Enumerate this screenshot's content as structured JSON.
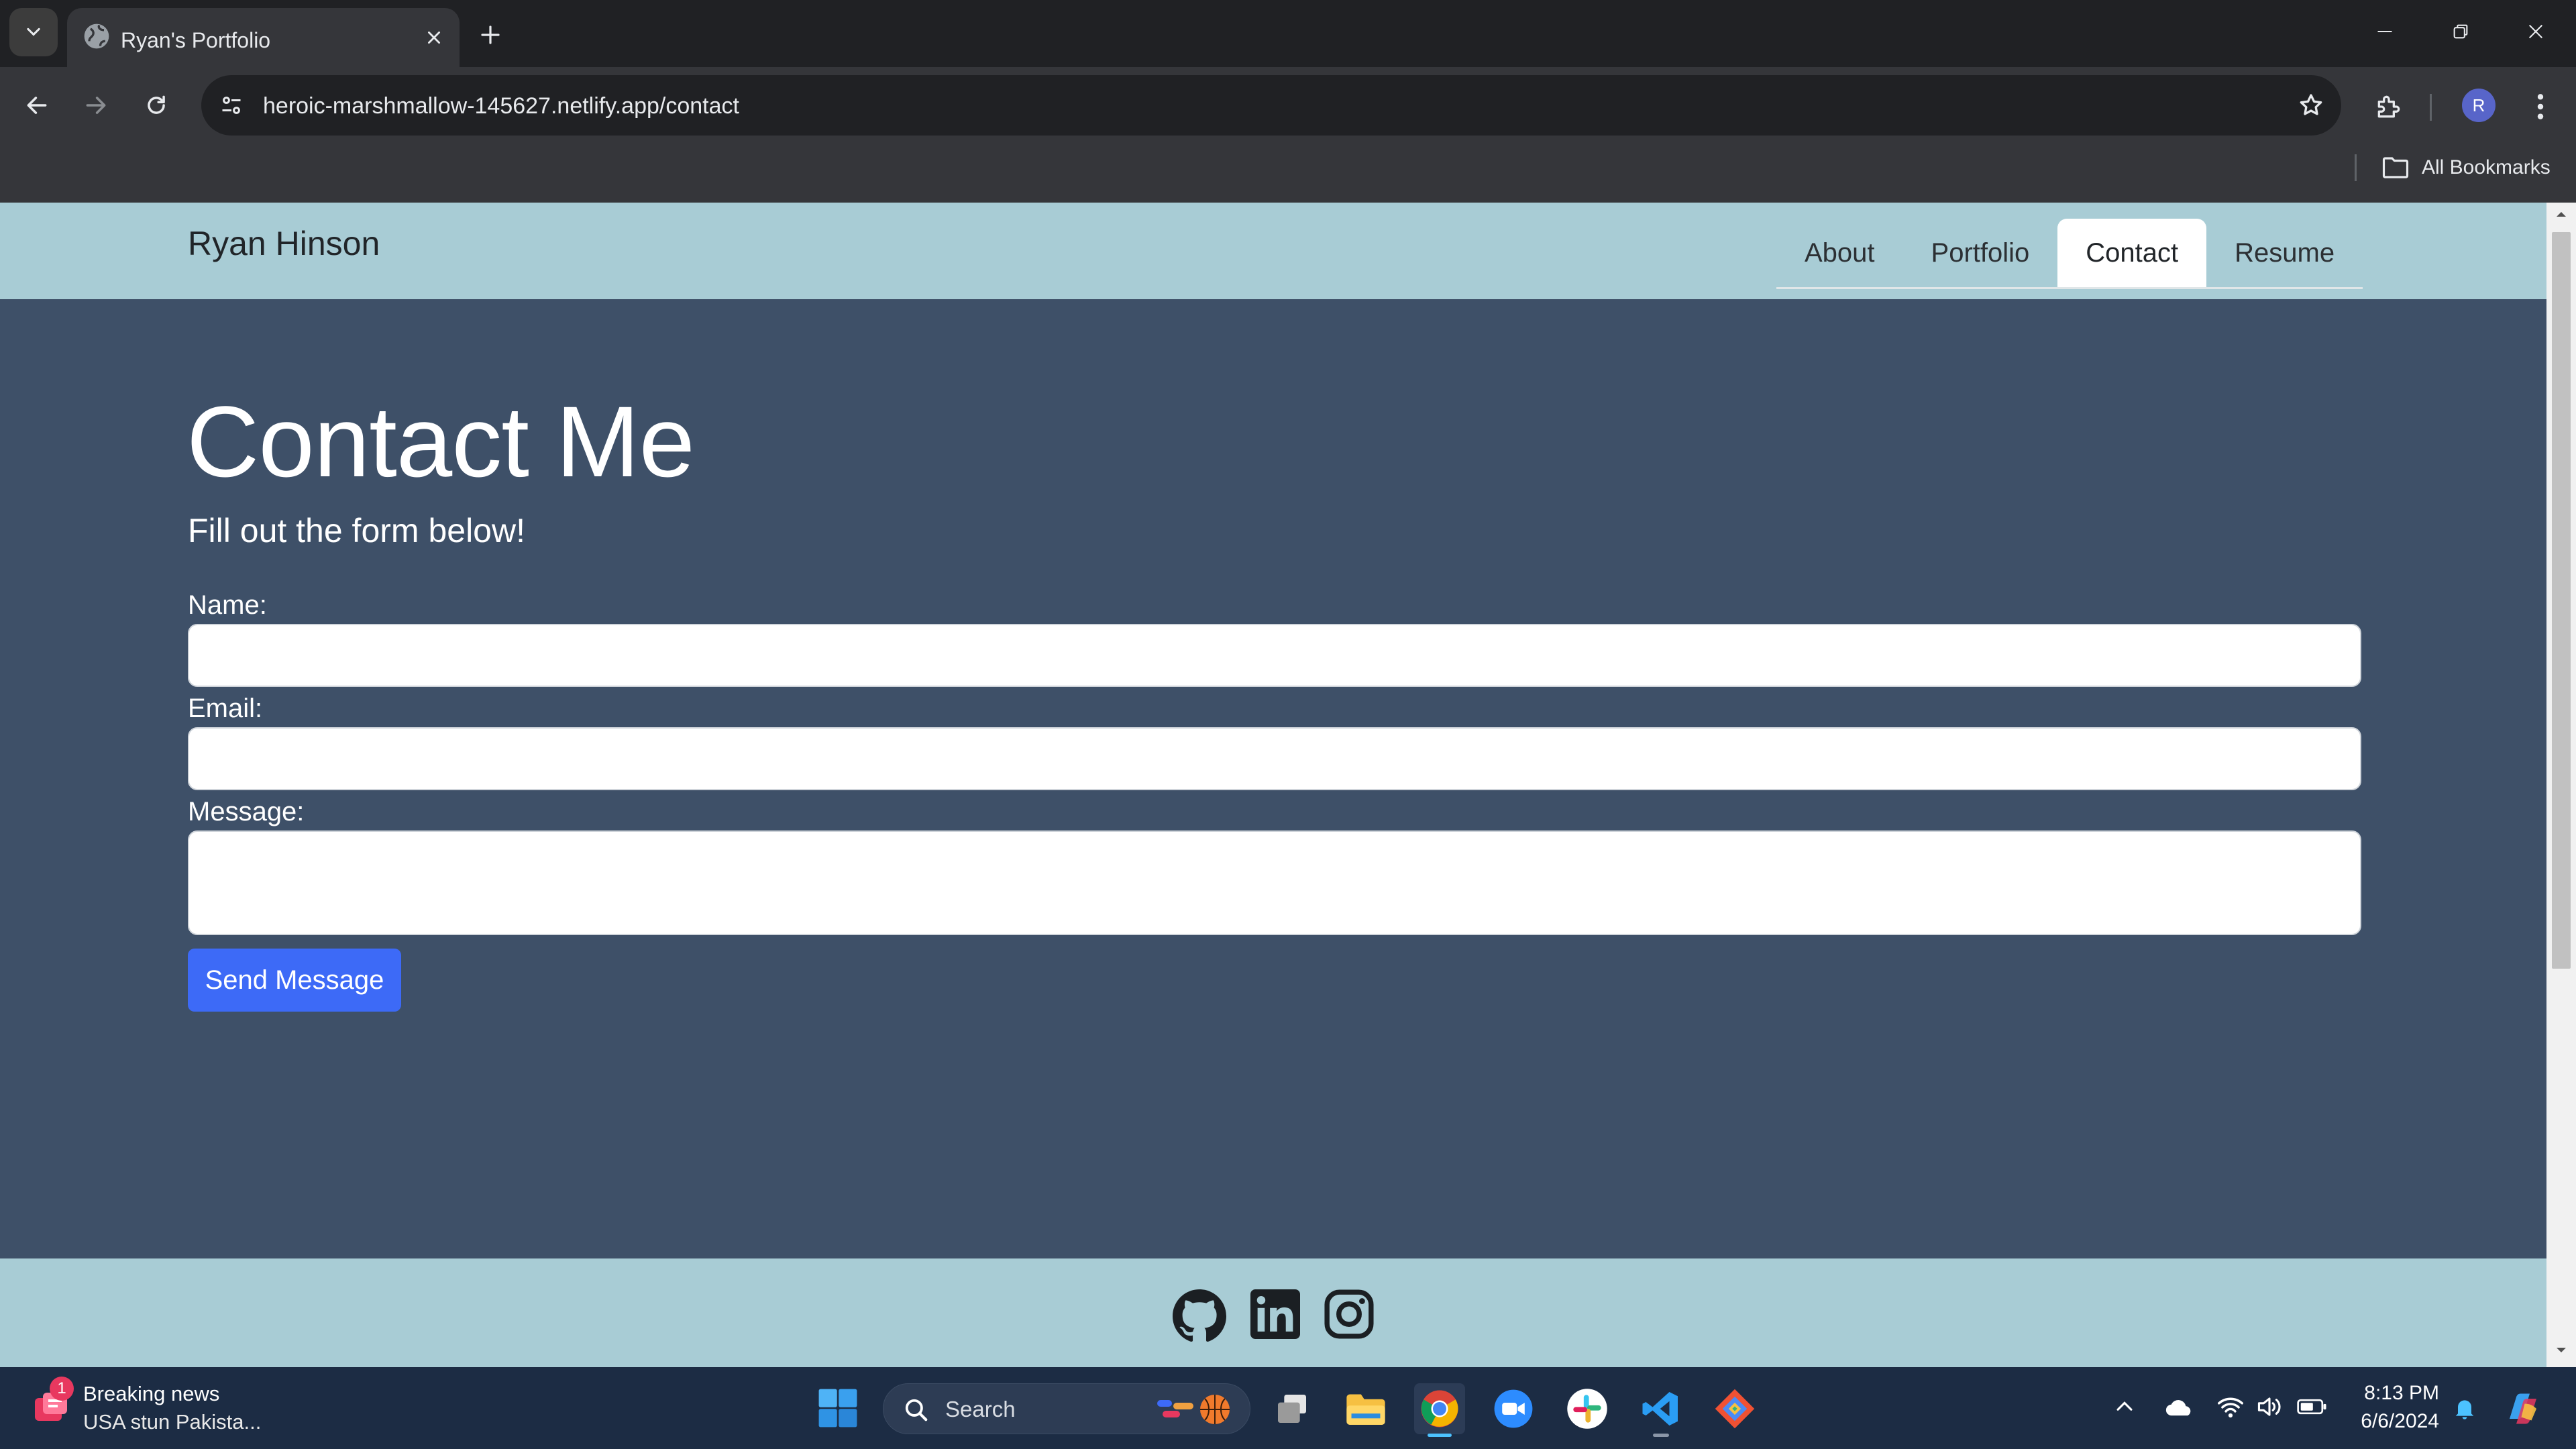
{
  "browser": {
    "tab_title": "Ryan's Portfolio",
    "url": "heroic-marshmallow-145627.netlify.app/contact",
    "profile_initial": "R",
    "bookmarks_label": "All Bookmarks"
  },
  "site": {
    "brand": "Ryan Hinson",
    "nav": [
      {
        "label": "About",
        "active": false
      },
      {
        "label": "Portfolio",
        "active": false
      },
      {
        "label": "Contact",
        "active": true
      },
      {
        "label": "Resume",
        "active": false
      }
    ],
    "heading": "Contact Me",
    "subheading": "Fill out the form below!",
    "form": {
      "name_label": "Name:",
      "email_label": "Email:",
      "message_label": "Message:",
      "name_value": "",
      "email_value": "",
      "message_value": "",
      "submit_label": "Send Message"
    },
    "footer_icons": [
      "github-icon",
      "linkedin-icon",
      "instagram-icon"
    ]
  },
  "taskbar": {
    "news_badge": "1",
    "news_title": "Breaking news",
    "news_subtitle": "USA stun Pakista...",
    "search_label": "Search",
    "apps": [
      "task-view",
      "file-explorer",
      "chrome",
      "zoom",
      "slack",
      "vscode",
      "git"
    ],
    "time": "8:13 PM",
    "date": "6/6/2024"
  },
  "colors": {
    "header_bg": "#a8ccd5",
    "page_bg": "#3e5068",
    "button_blue": "#3d6af7"
  }
}
